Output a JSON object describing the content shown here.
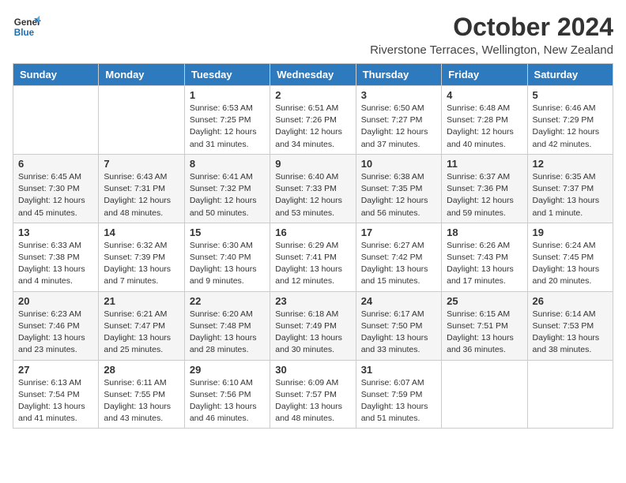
{
  "header": {
    "logo_line1": "General",
    "logo_line2": "Blue",
    "month_title": "October 2024",
    "subtitle": "Riverstone Terraces, Wellington, New Zealand"
  },
  "weekdays": [
    "Sunday",
    "Monday",
    "Tuesday",
    "Wednesday",
    "Thursday",
    "Friday",
    "Saturday"
  ],
  "weeks": [
    [
      {
        "day": "",
        "detail": ""
      },
      {
        "day": "",
        "detail": ""
      },
      {
        "day": "1",
        "detail": "Sunrise: 6:53 AM\nSunset: 7:25 PM\nDaylight: 12 hours and 31 minutes."
      },
      {
        "day": "2",
        "detail": "Sunrise: 6:51 AM\nSunset: 7:26 PM\nDaylight: 12 hours and 34 minutes."
      },
      {
        "day": "3",
        "detail": "Sunrise: 6:50 AM\nSunset: 7:27 PM\nDaylight: 12 hours and 37 minutes."
      },
      {
        "day": "4",
        "detail": "Sunrise: 6:48 AM\nSunset: 7:28 PM\nDaylight: 12 hours and 40 minutes."
      },
      {
        "day": "5",
        "detail": "Sunrise: 6:46 AM\nSunset: 7:29 PM\nDaylight: 12 hours and 42 minutes."
      }
    ],
    [
      {
        "day": "6",
        "detail": "Sunrise: 6:45 AM\nSunset: 7:30 PM\nDaylight: 12 hours and 45 minutes."
      },
      {
        "day": "7",
        "detail": "Sunrise: 6:43 AM\nSunset: 7:31 PM\nDaylight: 12 hours and 48 minutes."
      },
      {
        "day": "8",
        "detail": "Sunrise: 6:41 AM\nSunset: 7:32 PM\nDaylight: 12 hours and 50 minutes."
      },
      {
        "day": "9",
        "detail": "Sunrise: 6:40 AM\nSunset: 7:33 PM\nDaylight: 12 hours and 53 minutes."
      },
      {
        "day": "10",
        "detail": "Sunrise: 6:38 AM\nSunset: 7:35 PM\nDaylight: 12 hours and 56 minutes."
      },
      {
        "day": "11",
        "detail": "Sunrise: 6:37 AM\nSunset: 7:36 PM\nDaylight: 12 hours and 59 minutes."
      },
      {
        "day": "12",
        "detail": "Sunrise: 6:35 AM\nSunset: 7:37 PM\nDaylight: 13 hours and 1 minute."
      }
    ],
    [
      {
        "day": "13",
        "detail": "Sunrise: 6:33 AM\nSunset: 7:38 PM\nDaylight: 13 hours and 4 minutes."
      },
      {
        "day": "14",
        "detail": "Sunrise: 6:32 AM\nSunset: 7:39 PM\nDaylight: 13 hours and 7 minutes."
      },
      {
        "day": "15",
        "detail": "Sunrise: 6:30 AM\nSunset: 7:40 PM\nDaylight: 13 hours and 9 minutes."
      },
      {
        "day": "16",
        "detail": "Sunrise: 6:29 AM\nSunset: 7:41 PM\nDaylight: 13 hours and 12 minutes."
      },
      {
        "day": "17",
        "detail": "Sunrise: 6:27 AM\nSunset: 7:42 PM\nDaylight: 13 hours and 15 minutes."
      },
      {
        "day": "18",
        "detail": "Sunrise: 6:26 AM\nSunset: 7:43 PM\nDaylight: 13 hours and 17 minutes."
      },
      {
        "day": "19",
        "detail": "Sunrise: 6:24 AM\nSunset: 7:45 PM\nDaylight: 13 hours and 20 minutes."
      }
    ],
    [
      {
        "day": "20",
        "detail": "Sunrise: 6:23 AM\nSunset: 7:46 PM\nDaylight: 13 hours and 23 minutes."
      },
      {
        "day": "21",
        "detail": "Sunrise: 6:21 AM\nSunset: 7:47 PM\nDaylight: 13 hours and 25 minutes."
      },
      {
        "day": "22",
        "detail": "Sunrise: 6:20 AM\nSunset: 7:48 PM\nDaylight: 13 hours and 28 minutes."
      },
      {
        "day": "23",
        "detail": "Sunrise: 6:18 AM\nSunset: 7:49 PM\nDaylight: 13 hours and 30 minutes."
      },
      {
        "day": "24",
        "detail": "Sunrise: 6:17 AM\nSunset: 7:50 PM\nDaylight: 13 hours and 33 minutes."
      },
      {
        "day": "25",
        "detail": "Sunrise: 6:15 AM\nSunset: 7:51 PM\nDaylight: 13 hours and 36 minutes."
      },
      {
        "day": "26",
        "detail": "Sunrise: 6:14 AM\nSunset: 7:53 PM\nDaylight: 13 hours and 38 minutes."
      }
    ],
    [
      {
        "day": "27",
        "detail": "Sunrise: 6:13 AM\nSunset: 7:54 PM\nDaylight: 13 hours and 41 minutes."
      },
      {
        "day": "28",
        "detail": "Sunrise: 6:11 AM\nSunset: 7:55 PM\nDaylight: 13 hours and 43 minutes."
      },
      {
        "day": "29",
        "detail": "Sunrise: 6:10 AM\nSunset: 7:56 PM\nDaylight: 13 hours and 46 minutes."
      },
      {
        "day": "30",
        "detail": "Sunrise: 6:09 AM\nSunset: 7:57 PM\nDaylight: 13 hours and 48 minutes."
      },
      {
        "day": "31",
        "detail": "Sunrise: 6:07 AM\nSunset: 7:59 PM\nDaylight: 13 hours and 51 minutes."
      },
      {
        "day": "",
        "detail": ""
      },
      {
        "day": "",
        "detail": ""
      }
    ]
  ]
}
